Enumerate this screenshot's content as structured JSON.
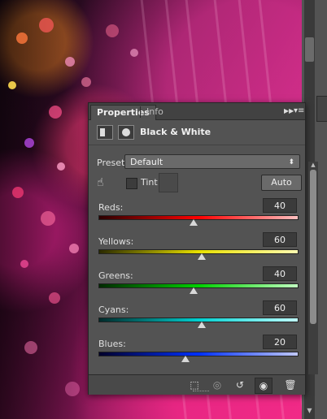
{
  "panel": {
    "tabs": [
      {
        "label": "Properties",
        "active": true
      },
      {
        "label": "Info",
        "active": false
      }
    ],
    "title": "Black & White",
    "preset": {
      "label": "Preset:",
      "value": "Default"
    },
    "tint": {
      "label": "Tint",
      "checked": false
    },
    "auto_label": "Auto",
    "sliders": [
      {
        "label": "Reds:",
        "value": "40",
        "gradient": [
          "#2a0000",
          "#ff0000",
          "#ffc0c0"
        ],
        "position": 0.48
      },
      {
        "label": "Yellows:",
        "value": "60",
        "gradient": [
          "#2a2a00",
          "#e8e000",
          "#fffbb0"
        ],
        "position": 0.52
      },
      {
        "label": "Greens:",
        "value": "40",
        "gradient": [
          "#002a00",
          "#00d000",
          "#c0ffc0"
        ],
        "position": 0.48
      },
      {
        "label": "Cyans:",
        "value": "60",
        "gradient": [
          "#002a2a",
          "#00d0d0",
          "#c0ffff"
        ],
        "position": 0.52
      },
      {
        "label": "Blues:",
        "value": "20",
        "gradient": [
          "#00002a",
          "#0030ff",
          "#c0c8ff"
        ],
        "position": 0.44
      }
    ],
    "footer_icons": [
      "clip-to-layer-icon",
      "view-previous-icon",
      "reset-icon",
      "visibility-eye-icon",
      "trash-icon"
    ]
  },
  "colors": {
    "panel_bg": "#535353",
    "tab_bar_bg": "#424242",
    "canvas_accent": "#d5307c"
  }
}
